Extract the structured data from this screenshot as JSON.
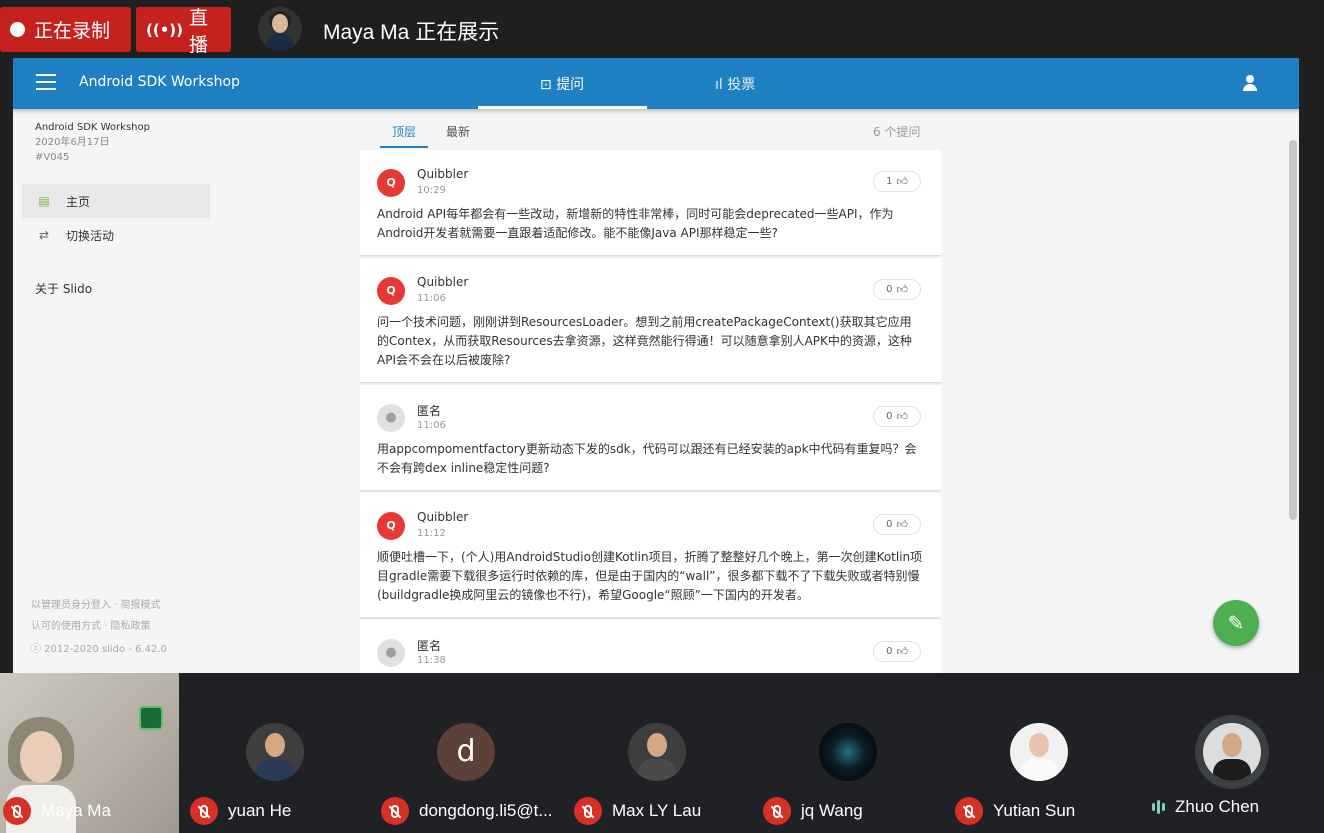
{
  "meeting": {
    "recording_label": "正在录制",
    "live_label": "直播",
    "presenter_text": "Maya Ma 正在展示"
  },
  "app": {
    "title": "Android SDK Workshop",
    "tab_questions": "提问",
    "tab_polls": "投票"
  },
  "sidebar": {
    "event_name": "Android SDK Workshop",
    "event_date": "2020年6月17日",
    "event_code": "#V045",
    "nav_home": "主页",
    "nav_switch": "切换活动",
    "about": "关于 Slido",
    "footer_login": "以管理员身分登入 · 简报模式",
    "footer_terms": "认可的使用方式 · 隐私政策",
    "footer_copyright": "ⓒ 2012-2020 slido - 6.42.0"
  },
  "feed": {
    "tab_top": "顶层",
    "tab_newest": "最新",
    "count": "6 个提问",
    "questions": [
      {
        "author": "Quibbler",
        "avatar": "Q",
        "time": "10:29",
        "likes": "1",
        "text": "Android API每年都会有一些改动，新增新的特性非常棒，同时可能会deprecated一些API，作为Android开发者就需要一直跟着适配修改。能不能像Java API那样稳定一些?"
      },
      {
        "author": "Quibbler",
        "avatar": "Q",
        "time": "11:06",
        "likes": "0",
        "text": "问一个技术问题，刚刚讲到ResourcesLoader。想到之前用createPackageContext()获取其它应用的Contex，从而获取Resources去拿资源，这样竟然能行得通！可以随意拿别人APK中的资源，这种API会不会在以后被废除?"
      },
      {
        "author": "匿名",
        "avatar": "",
        "time": "11:06",
        "likes": "0",
        "text": "用appcompomentfactory更新动态下发的sdk，代码可以跟还有已经安装的apk中代码有重复吗？会不会有跨dex inline稳定性问题?"
      },
      {
        "author": "Quibbler",
        "avatar": "Q",
        "time": "11:12",
        "likes": "0",
        "text": "顺便吐槽一下，(个人)用AndroidStudio创建Kotlin项目，折腾了整整好几个晚上，第一次创建Kotlin项目gradle需要下载很多运行时依赖的库，但是由于国内的“wall”，很多都下载不了下载失败或者特别慢(buildgradle换成阿里云的镜像也不行)，希望Google“照顾”一下国内的开发者。"
      },
      {
        "author": "匿名",
        "avatar": "",
        "time": "11:38",
        "likes": "0",
        "text": ""
      }
    ]
  },
  "participants": [
    {
      "name": "Maya Ma",
      "avatar_letter": ""
    },
    {
      "name": "yuan He",
      "avatar_letter": ""
    },
    {
      "name": "dongdong.li5@t...",
      "avatar_letter": "d"
    },
    {
      "name": "Max LY Lau",
      "avatar_letter": ""
    },
    {
      "name": "jq Wang",
      "avatar_letter": ""
    },
    {
      "name": "Yutian Sun",
      "avatar_letter": ""
    },
    {
      "name": "Zhuo Chen",
      "avatar_letter": ""
    }
  ],
  "colors": {
    "record_red": "#c5221f",
    "slido_blue": "#1e7fc3",
    "fab_green": "#4caf50",
    "question_avatar_red": "#e53935"
  }
}
